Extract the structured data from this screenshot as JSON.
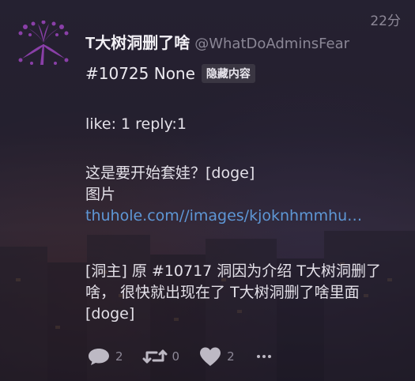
{
  "post": {
    "time": "22分",
    "author_name": "T大树洞删了啥",
    "author_handle": "@WhatDoAdminsFear",
    "id_line": "#10725 None",
    "badge": "隐藏内容",
    "stats": "like: 1 reply:1",
    "body_line1": "这是要开始套娃？[doge]",
    "body_line2": "图片",
    "link": "thuhole.com//images/kjoknhmmhu…",
    "reply_text": "[洞主] 原 #10717 洞因为介绍 T大树洞删了啥， 很快就出现在了 T大树洞删了啥里面 [doge]"
  },
  "actions": {
    "reply_count": "2",
    "retweet_count": "0",
    "like_count": "2",
    "icons": [
      "speech-bubble-icon",
      "retweet-icon",
      "heart-icon",
      "more-icon"
    ]
  },
  "colors": {
    "avatar_purple": "#8a3fa8",
    "link_blue": "#5e97d6",
    "muted_gray": "#8d8897"
  }
}
